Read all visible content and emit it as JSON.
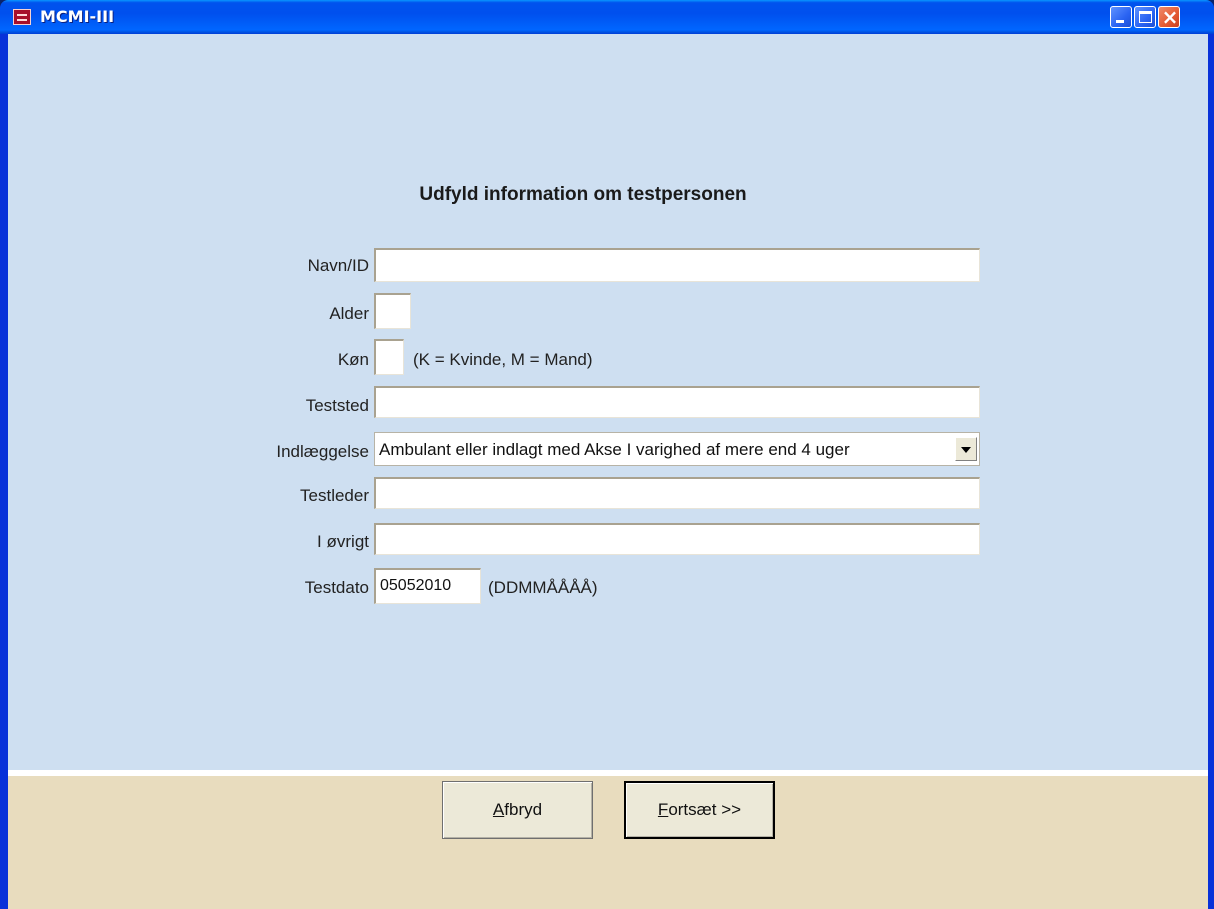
{
  "window": {
    "title": "MCMI-III"
  },
  "form": {
    "heading": "Udfyld information om testpersonen",
    "fields": {
      "name": {
        "label": "Navn/ID",
        "value": ""
      },
      "age": {
        "label": "Alder",
        "value": ""
      },
      "sex": {
        "label": "Køn",
        "value": "",
        "hint": "(K = Kvinde, M = Mand)"
      },
      "place": {
        "label": "Teststed",
        "value": ""
      },
      "admission": {
        "label": "Indlæggelse",
        "value": "Ambulant eller indlagt med Akse I varighed af mere end 4 uger"
      },
      "leader": {
        "label": "Testleder",
        "value": ""
      },
      "other": {
        "label": "I øvrigt",
        "value": ""
      },
      "date": {
        "label": "Testdato",
        "value": "05052010",
        "hint": "(DDMMÅÅÅÅ)"
      }
    }
  },
  "buttons": {
    "cancel": {
      "mnemonic": "A",
      "rest": "fbryd"
    },
    "continue": {
      "mnemonic": "F",
      "rest": "ortsæt >>"
    }
  },
  "icons": {
    "app": "mcmi-app-icon",
    "minimize": "minimize-icon",
    "maximize": "maximize-icon",
    "close": "close-icon",
    "dropdown": "chevron-down-icon"
  }
}
